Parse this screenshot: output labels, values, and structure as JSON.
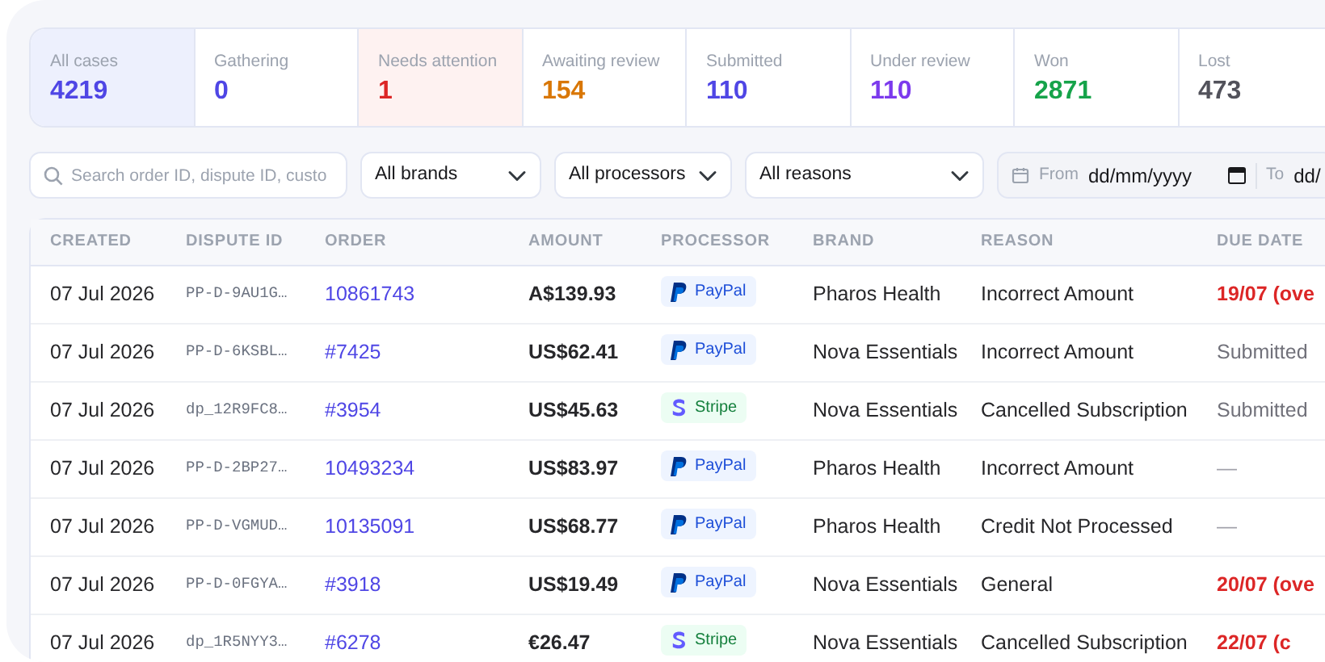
{
  "stats": [
    {
      "label": "All cases",
      "value": "4219",
      "color": "#4f46e5",
      "selected": true,
      "kind": "normal"
    },
    {
      "label": "Gathering",
      "value": "0",
      "color": "#4f46e5",
      "selected": false,
      "kind": "normal"
    },
    {
      "label": "Needs attention",
      "value": "1",
      "color": "#dc2626",
      "selected": false,
      "kind": "alert"
    },
    {
      "label": "Awaiting review",
      "value": "154",
      "color": "#d97706",
      "selected": false,
      "kind": "normal"
    },
    {
      "label": "Submitted",
      "value": "110",
      "color": "#4f46e5",
      "selected": false,
      "kind": "normal"
    },
    {
      "label": "Under review",
      "value": "110",
      "color": "#7c3aed",
      "selected": false,
      "kind": "normal"
    },
    {
      "label": "Won",
      "value": "2871",
      "color": "#16a34a",
      "selected": false,
      "kind": "normal"
    },
    {
      "label": "Lost",
      "value": "473",
      "color": "#52525b",
      "selected": false,
      "kind": "normal"
    }
  ],
  "filters": {
    "search": {
      "placeholder": "Search order ID, dispute ID, custo"
    },
    "selects": [
      "All brands",
      "All processors",
      "All reasons"
    ],
    "date_range": {
      "from_label": "From",
      "from_value": "dd/mm/yyyy",
      "to_label": "To",
      "to_value": "dd/"
    }
  },
  "table": {
    "columns": [
      "CREATED",
      "DISPUTE ID",
      "ORDER",
      "AMOUNT",
      "PROCESSOR",
      "BRAND",
      "REASON",
      "DUE DATE"
    ],
    "rows": [
      {
        "created": "07 Jul 2026",
        "dispute_id": "PP-D-9AU1G…",
        "order": "10861743",
        "amount": "A$139.93",
        "processor": {
          "kind": "paypal",
          "label": "PayPal"
        },
        "brand": "Pharos Health",
        "reason": "Incorrect Amount",
        "due": {
          "kind": "overdue",
          "text": "19/07 (ove"
        }
      },
      {
        "created": "07 Jul 2026",
        "dispute_id": "PP-D-6KSBL…",
        "order": "#7425",
        "amount": "US$62.41",
        "processor": {
          "kind": "paypal",
          "label": "PayPal"
        },
        "brand": "Nova Essentials",
        "reason": "Incorrect Amount",
        "due": {
          "kind": "submitted",
          "text": "Submitted"
        }
      },
      {
        "created": "07 Jul 2026",
        "dispute_id": "dp_12R9FC8…",
        "order": "#3954",
        "amount": "US$45.63",
        "processor": {
          "kind": "stripe",
          "label": "Stripe"
        },
        "brand": "Nova Essentials",
        "reason": "Cancelled Subscription",
        "due": {
          "kind": "submitted",
          "text": "Submitted"
        }
      },
      {
        "created": "07 Jul 2026",
        "dispute_id": "PP-D-2BP27…",
        "order": "10493234",
        "amount": "US$83.97",
        "processor": {
          "kind": "paypal",
          "label": "PayPal"
        },
        "brand": "Pharos Health",
        "reason": "Incorrect Amount",
        "due": {
          "kind": "none",
          "text": "—"
        }
      },
      {
        "created": "07 Jul 2026",
        "dispute_id": "PP-D-VGMUD…",
        "order": "10135091",
        "amount": "US$68.77",
        "processor": {
          "kind": "paypal",
          "label": "PayPal"
        },
        "brand": "Pharos Health",
        "reason": "Credit Not Processed",
        "due": {
          "kind": "none",
          "text": "—"
        }
      },
      {
        "created": "07 Jul 2026",
        "dispute_id": "PP-D-0FGYA…",
        "order": "#3918",
        "amount": "US$19.49",
        "processor": {
          "kind": "paypal",
          "label": "PayPal"
        },
        "brand": "Nova Essentials",
        "reason": "General",
        "due": {
          "kind": "overdue",
          "text": "20/07 (ove"
        }
      },
      {
        "created": "07 Jul 2026",
        "dispute_id": "dp_1R5NYY3…",
        "order": "#6278",
        "amount": "€26.47",
        "processor": {
          "kind": "stripe",
          "label": "Stripe"
        },
        "brand": "Nova Essentials",
        "reason": "Cancelled Subscription",
        "due": {
          "kind": "overdue",
          "text": "22/07 (c"
        }
      }
    ]
  }
}
